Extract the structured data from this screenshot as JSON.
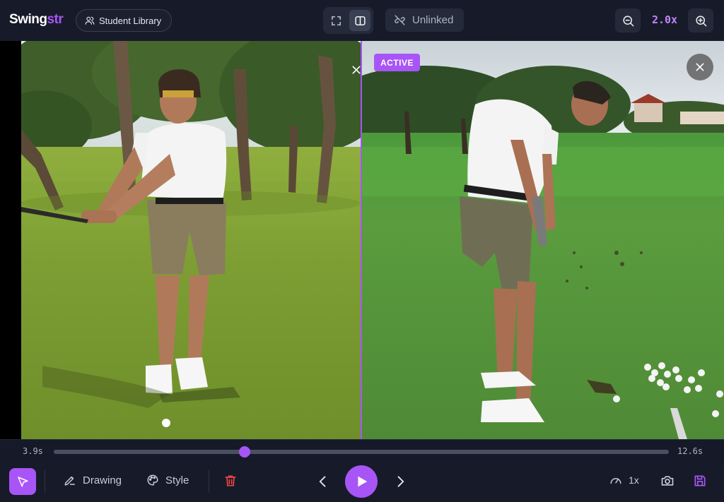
{
  "app": {
    "logo_main": "Swing",
    "logo_accent": "str"
  },
  "header": {
    "library_label": "Student Library",
    "link_status": "Unlinked",
    "zoom_level": "2.0x"
  },
  "viewer": {
    "active_badge": "ACTIVE"
  },
  "timeline": {
    "start": "3.9s",
    "end": "12.6s",
    "progress": 0.31
  },
  "toolbar": {
    "drawing_label": "Drawing",
    "style_label": "Style",
    "speed_label": "1x"
  },
  "colors": {
    "accent": "#a855f7",
    "background": "#161a28",
    "danger": "#ef4444"
  },
  "icons": [
    "users-icon",
    "fullscreen-icon",
    "split-view-icon",
    "unlink-icon",
    "zoom-out-icon",
    "zoom-in-icon",
    "close-icon",
    "cursor-icon",
    "pen-icon",
    "palette-icon",
    "trash-icon",
    "chevron-left-icon",
    "play-icon",
    "chevron-right-icon",
    "gauge-icon",
    "camera-icon",
    "save-icon"
  ]
}
